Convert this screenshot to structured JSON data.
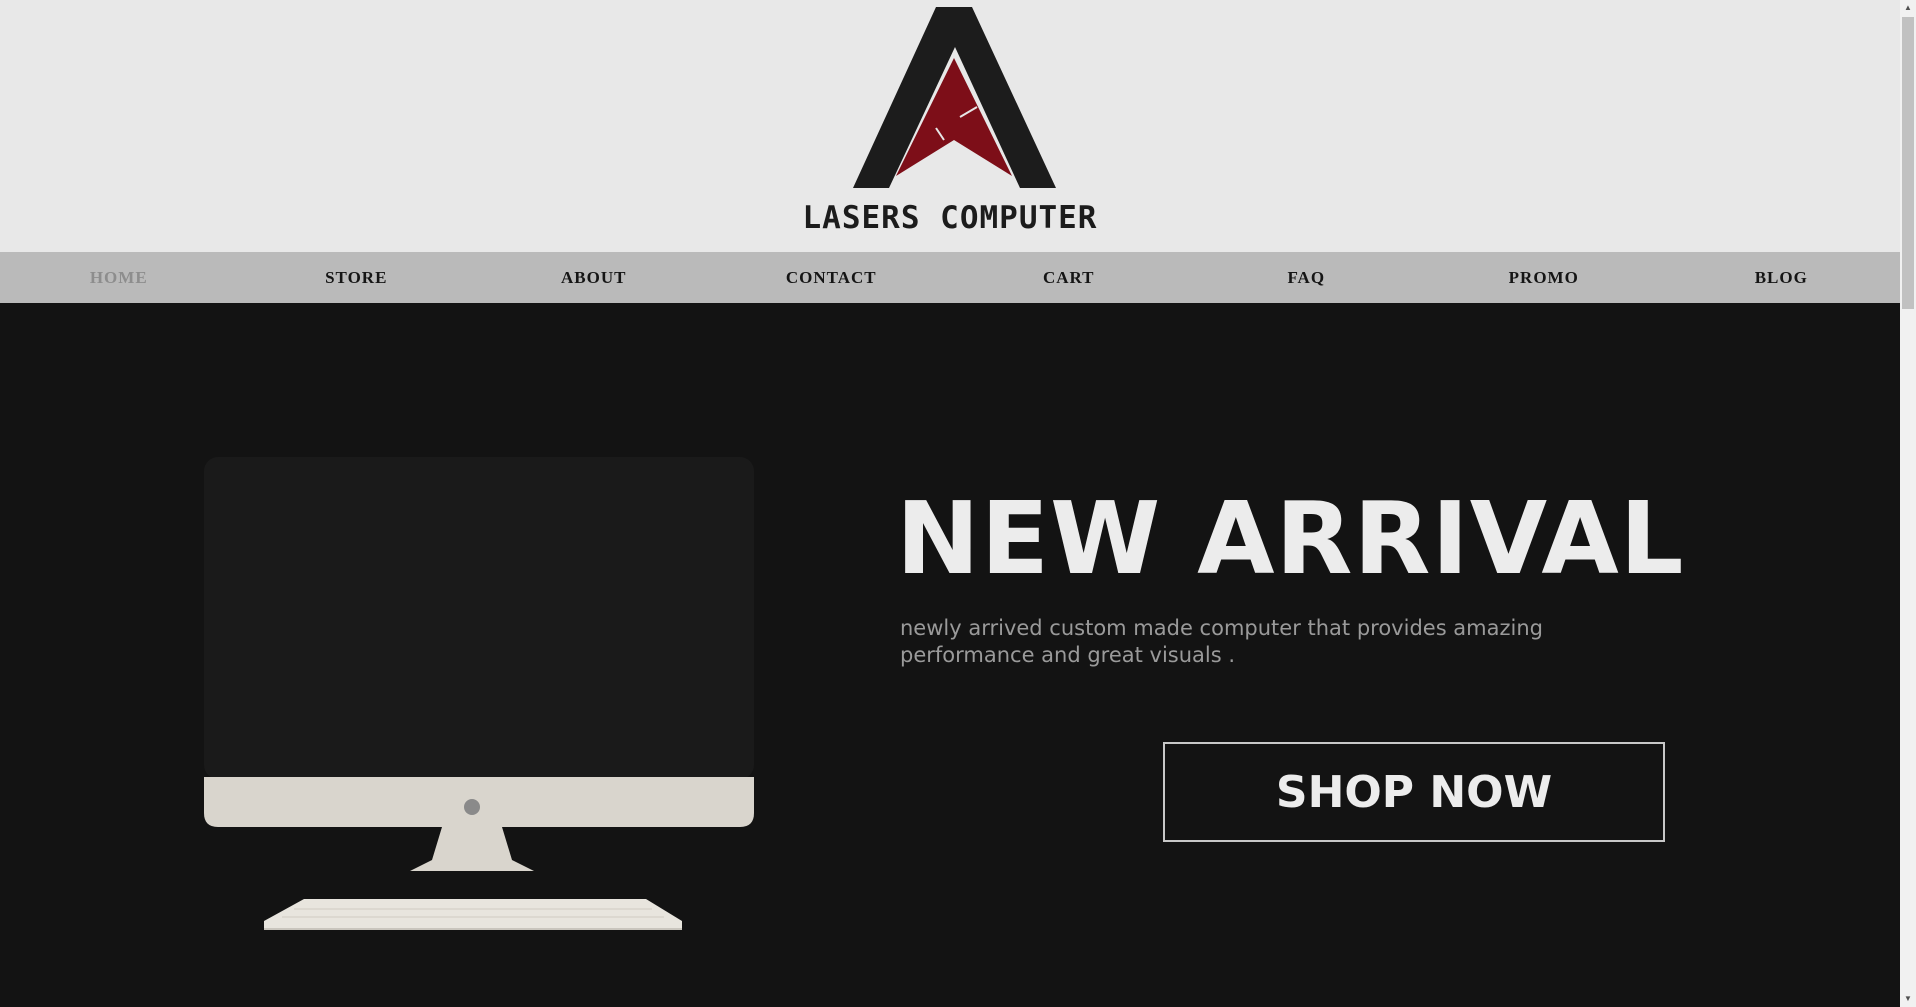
{
  "brand": {
    "name": "LASERS COMPUTER",
    "logo_icon": "triangle-a-logo-icon",
    "colors": {
      "dark": "#1c1c1c",
      "accent": "#7d0e18"
    }
  },
  "nav": {
    "items": [
      {
        "label": "HOME",
        "active": true
      },
      {
        "label": "STORE"
      },
      {
        "label": "ABOUT"
      },
      {
        "label": "CONTACT"
      },
      {
        "label": "CART"
      },
      {
        "label": "FAQ"
      },
      {
        "label": "PROMO"
      },
      {
        "label": "BLOG"
      }
    ]
  },
  "hero": {
    "title": "NEW ARRIVAL",
    "subtitle": "newly arrived custom made computer that provides amazing performance and great visuals .",
    "cta_label": "SHOP NOW",
    "image_icon": "desktop-computer-icon"
  },
  "scrollbar": {
    "up_icon": "scroll-up-arrow-icon",
    "down_icon": "scroll-down-arrow-icon",
    "up_glyph": "▲",
    "down_glyph": "▼"
  }
}
